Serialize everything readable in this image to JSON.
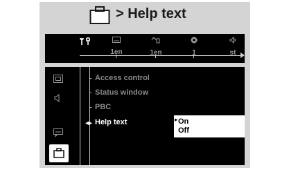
{
  "header": {
    "title": "> Help text",
    "icon": "briefcase-icon"
  },
  "topbar": {
    "setup_icon": "setup-icon",
    "items": [
      {
        "icon": "subtitle-icon",
        "value": "1en"
      },
      {
        "icon": "audio-icon",
        "value": "1en"
      },
      {
        "icon": "angle-icon",
        "value": "1"
      },
      {
        "icon": "sound-mode-icon",
        "value": "st"
      }
    ]
  },
  "sidebar": {
    "items": [
      {
        "icon": "picture-icon"
      },
      {
        "icon": "speaker-icon"
      },
      {
        "icon": "language-icon"
      },
      {
        "icon": "briefcase-icon",
        "selected": true
      }
    ]
  },
  "menu": {
    "items": [
      {
        "label": "Access control"
      },
      {
        "label": "Status window"
      },
      {
        "label": "PBC"
      },
      {
        "label": "Help text",
        "selected": true
      }
    ]
  },
  "options": {
    "items": [
      {
        "label": "On",
        "selected": true
      },
      {
        "label": "Off"
      }
    ]
  },
  "colors": {
    "frame": "#d4d4d4",
    "panel": "#000000",
    "text_dim": "#8a8a8a",
    "text_active": "#ffffff",
    "options_bg": "#ffffff"
  }
}
